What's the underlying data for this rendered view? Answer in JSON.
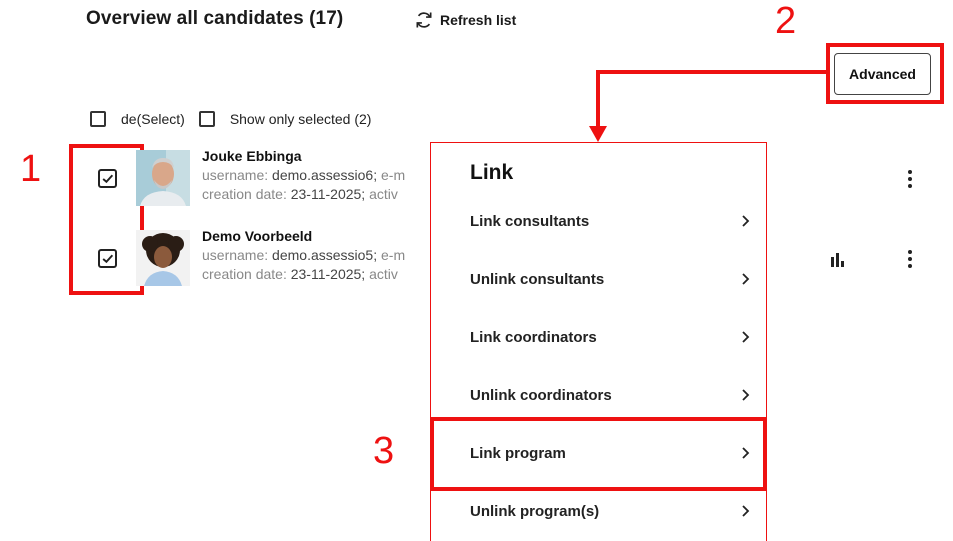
{
  "header": {
    "title": "Overview all candidates (17)",
    "refresh_label": "Refresh list"
  },
  "advanced_label": "Advanced",
  "selection": {
    "deselect_label": "de(Select)",
    "show_selected_label": "Show only selected (2)"
  },
  "candidates": [
    {
      "name": "Jouke Ebbinga",
      "username_key": "username:",
      "username_value": "demo.assessio6;",
      "email_key": "e-m",
      "creation_key": "creation date:",
      "creation_value": "23-11-2025;",
      "active_key": "activ"
    },
    {
      "name": "Demo Voorbeeld",
      "username_key": "username:",
      "username_value": "demo.assessio5;",
      "email_key": "e-m",
      "creation_key": "creation date:",
      "creation_value": "23-11-2025;",
      "active_key": "activ"
    }
  ],
  "menu": {
    "title": "Link",
    "items": [
      {
        "label": "Link consultants"
      },
      {
        "label": "Unlink consultants"
      },
      {
        "label": "Link coordinators"
      },
      {
        "label": "Unlink coordinators"
      },
      {
        "label": "Link program"
      },
      {
        "label": "Unlink program(s)"
      }
    ]
  },
  "annotations": {
    "one": "1",
    "two": "2",
    "three": "3",
    "color": "#ee1111"
  }
}
